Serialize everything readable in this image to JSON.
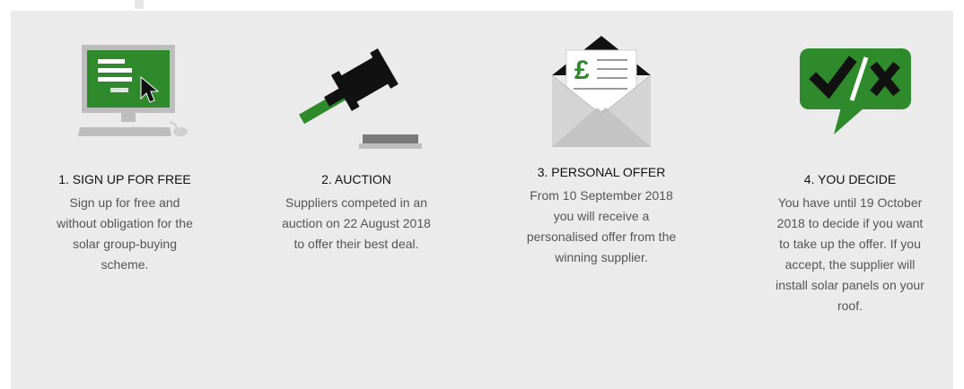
{
  "steps": [
    {
      "title": "1. SIGN UP FOR FREE",
      "description": "Sign up for free and without obligation for the solar group-buying scheme.",
      "icon": "computer-signup-icon"
    },
    {
      "title": "2. AUCTION",
      "description": "Suppliers competed in an auction on 22 August 2018 to offer their best deal.",
      "icon": "auction-gavel-icon"
    },
    {
      "title": "3. PERSONAL OFFER",
      "description": "From 10 September 2018 you will receive a personalised offer from the winning supplier.",
      "icon": "envelope-offer-icon",
      "icon_symbol": "£"
    },
    {
      "title": "4. YOU DECIDE",
      "description": "You have until 19 October 2018 to decide if you want to take up the offer. If you accept, the supplier will install solar panels on your roof.",
      "icon": "decision-bubble-icon"
    }
  ],
  "colors": {
    "accent_green": "#2f8a2b",
    "panel_bg": "#ebebeb",
    "title": "#111111",
    "text": "#555555"
  }
}
